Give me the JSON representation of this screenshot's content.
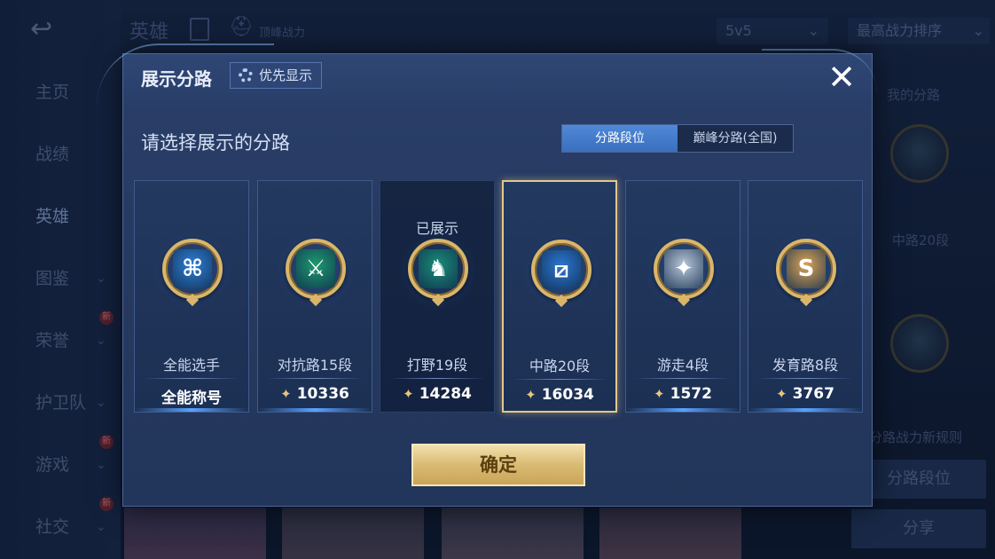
{
  "background": {
    "back_icon": "↩",
    "nav": [
      {
        "label": "主页"
      },
      {
        "label": "战绩"
      },
      {
        "label": "英雄"
      },
      {
        "label": "图鉴",
        "chevron": "⌄"
      },
      {
        "label": "荣誉",
        "chevron": "⌄",
        "badge": "新"
      },
      {
        "label": "护卫队",
        "chevron": "⌄"
      },
      {
        "label": "游戏",
        "chevron": "⌄",
        "badge": "新"
      },
      {
        "label": "社交",
        "chevron": "⌄",
        "badge": "新"
      }
    ],
    "title": "英雄",
    "subtitle": "顶峰战力",
    "mode_select": "5v5",
    "sort_select": "最高战力排序",
    "right_panel": {
      "my_lanes_label": "我的分路",
      "lane_text": "中路20段",
      "rules_text": "分路战力新规则",
      "lane_rank_button": "分路段位",
      "share_button": "分享"
    }
  },
  "modal": {
    "title": "展示分路",
    "priority_button": "优先显示",
    "close_icon": "✕",
    "section_label": "请选择展示的分路",
    "tabs": [
      {
        "label": "分路段位",
        "active": true
      },
      {
        "label": "巅峰分路(全国)",
        "active": false
      }
    ],
    "cards": [
      {
        "name": "全能选手",
        "value": "全能称号",
        "emblem_color": "#2f7fd6",
        "emblem_glyph": "⌘",
        "icon": "all-round-emblem-icon",
        "shown": false,
        "selected": false
      },
      {
        "name": "对抗路15段",
        "value": "10336",
        "emblem_color": "#1e9a6f",
        "emblem_glyph": "⚔",
        "icon": "clash-lane-emblem-icon",
        "shown": false,
        "selected": false
      },
      {
        "name": "打野19段",
        "value": "14284",
        "emblem_color": "#1a8c78",
        "emblem_glyph": "♞",
        "icon": "jungle-emblem-icon",
        "shown": true,
        "selected": false
      },
      {
        "name": "中路20段",
        "value": "16034",
        "emblem_color": "#2c77d2",
        "emblem_glyph": "⧄",
        "icon": "mid-lane-emblem-icon",
        "shown": false,
        "selected": true
      },
      {
        "name": "游走4段",
        "value": "1572",
        "emblem_color": "#b8c6d8",
        "emblem_glyph": "✦",
        "icon": "roam-emblem-icon",
        "shown": false,
        "selected": false
      },
      {
        "name": "发育路8段",
        "value": "3767",
        "emblem_color": "#d9a457",
        "emblem_glyph": "S",
        "icon": "farm-lane-emblem-icon",
        "shown": false,
        "selected": false
      }
    ],
    "shown_tag": "已展示",
    "score_icon": "✦",
    "confirm_button": "确定"
  }
}
